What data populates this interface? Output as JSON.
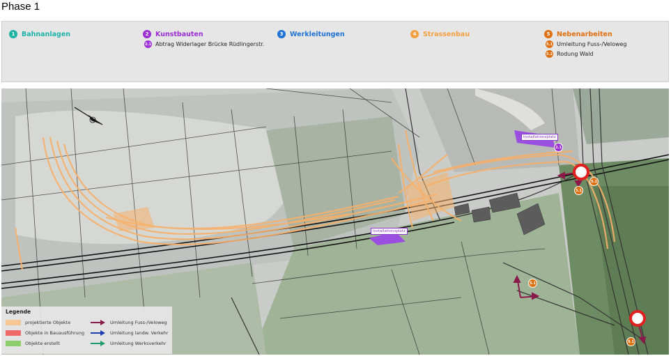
{
  "title": "Phase 1",
  "categories": [
    {
      "num": "1",
      "label": "Bahnanlagen",
      "color": "#1fb3a8",
      "items": []
    },
    {
      "num": "2",
      "label": "Kunstbauten",
      "color": "#9c2fd6",
      "items": [
        {
          "num": "2.1",
          "label": "Abtrag Widerlager Brücke Rüdlingerstr."
        }
      ]
    },
    {
      "num": "3",
      "label": "Werkleitungen",
      "color": "#1f73d6",
      "items": []
    },
    {
      "num": "4",
      "label": "Strassenbau",
      "color": "#f5a040",
      "items": []
    },
    {
      "num": "5",
      "label": "Nebenarbeiten",
      "color": "#e0700f",
      "items": [
        {
          "num": "5.1",
          "label": "Umleitung Fuss-/Veloweg"
        },
        {
          "num": "5.2",
          "label": "Rodung Wald"
        }
      ]
    }
  ],
  "map": {
    "labels": {
      "installation_1": "Installationsplatz",
      "installation_2": "Installationsplatz"
    },
    "markers": [
      {
        "id": "m21",
        "num": "2.1",
        "color": "#9c2fd6"
      },
      {
        "id": "m52a",
        "num": "5.2",
        "color": "#e0700f"
      },
      {
        "id": "m51a",
        "num": "5.1",
        "color": "#e0700f"
      },
      {
        "id": "m51b",
        "num": "5.1",
        "color": "#e0700f"
      },
      {
        "id": "m51c",
        "num": "5.1",
        "color": "#e0700f"
      }
    ]
  },
  "legend": {
    "title": "Legende",
    "items": [
      {
        "label": "projektierte Objekte",
        "kind": "swatch",
        "color": "#f7c695"
      },
      {
        "label": "Objekte in Bauausführung",
        "kind": "swatch",
        "color": "#f06a6a"
      },
      {
        "label": "Objekte erstellt",
        "kind": "swatch",
        "color": "#8ccf6a"
      },
      {
        "label": "Umleitung Fuss-/Veloweg",
        "kind": "arrow",
        "color": "#8a1a4a"
      },
      {
        "label": "Umleitung landw. Verkehr",
        "kind": "arrow",
        "color": "#1f3fb0"
      },
      {
        "label": "Umleitung Werksverkehr",
        "kind": "arrow",
        "color": "#1f9a6a"
      }
    ]
  }
}
